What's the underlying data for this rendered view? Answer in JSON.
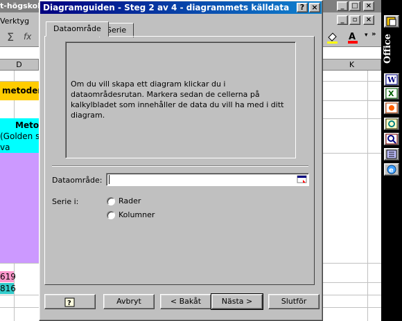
{
  "background": {
    "title_fragment": "t-högskol",
    "menu_fragment": "Verktyg",
    "column_letters": [
      "D",
      "K"
    ],
    "cells": [
      "metoder",
      "Meto",
      "(Golden s",
      "va",
      "619",
      "816"
    ],
    "colors": {
      "orange": "#ffcc00",
      "cyan": "#00ffff",
      "purple": "#cc99ff",
      "pink": "#ff99cc",
      "teal": "#33cccc"
    }
  },
  "office_bar": {
    "label": "Office",
    "icons": [
      "word-icon",
      "excel-icon",
      "powerpoint-icon",
      "outlook-icon",
      "access-icon",
      "binder-icon",
      "internet-explorer-icon"
    ]
  },
  "dialog": {
    "title": "Diagramguiden - Steg 2 av 4 - diagrammets källdata",
    "title_buttons": {
      "help": "?",
      "close": "×"
    },
    "tabs": [
      {
        "label": "Dataområde",
        "active": true
      },
      {
        "label": "Serie",
        "active": false
      }
    ],
    "description": "Om du vill skapa ett diagram klickar du i dataområdesrutan. Markera sedan de cellerna på kalkylbladet som innehåller de data du vill ha med i ditt diagram.",
    "data_range": {
      "label": "Dataområde:",
      "value": ""
    },
    "series_in": {
      "label": "Serie i:",
      "options": [
        {
          "label": "Rader",
          "selected": false
        },
        {
          "label": "Kolumner",
          "selected": false
        }
      ]
    },
    "buttons": {
      "help": "?",
      "cancel": "Avbryt",
      "back": "< Bakåt",
      "next": "Nästa >",
      "finish": "Slutför"
    }
  }
}
